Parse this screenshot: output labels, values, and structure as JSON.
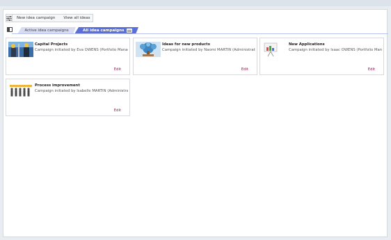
{
  "toolbar": {
    "settings_icon": "sliders-icon",
    "new_campaign_label": "New idea campaign",
    "view_all_label": "View all ideas"
  },
  "tabs": {
    "sidebar_icon": "sidebar-toggle-icon",
    "active_label": "Active idea campaigns",
    "all_label": "All idea campaigns",
    "menu_icon": "menu-icon",
    "accent_color": "#5b6fd8"
  },
  "cards": [
    {
      "title": "Capital Projects",
      "subtitle": "Campaign initiated by Eva OWENS (Portfolio Manag",
      "edit_label": "Edit",
      "image": "construction-workers-image"
    },
    {
      "title": "Ideas for new products",
      "subtitle": "Campaign initiated by Naomi MARTIN (Administrato",
      "edit_label": "Edit",
      "image": "idea-tree-image"
    },
    {
      "title": "New Applications",
      "subtitle": "Campaign initiated by Isaac OWENS (Portfolio Mana",
      "edit_label": "Edit",
      "image": "presentation-board-image"
    },
    {
      "title": "Process improvement",
      "subtitle": "Campaign initiated by Isabelle MARTIN (Administrat",
      "edit_label": "Edit",
      "image": "team-puzzle-image"
    }
  ]
}
